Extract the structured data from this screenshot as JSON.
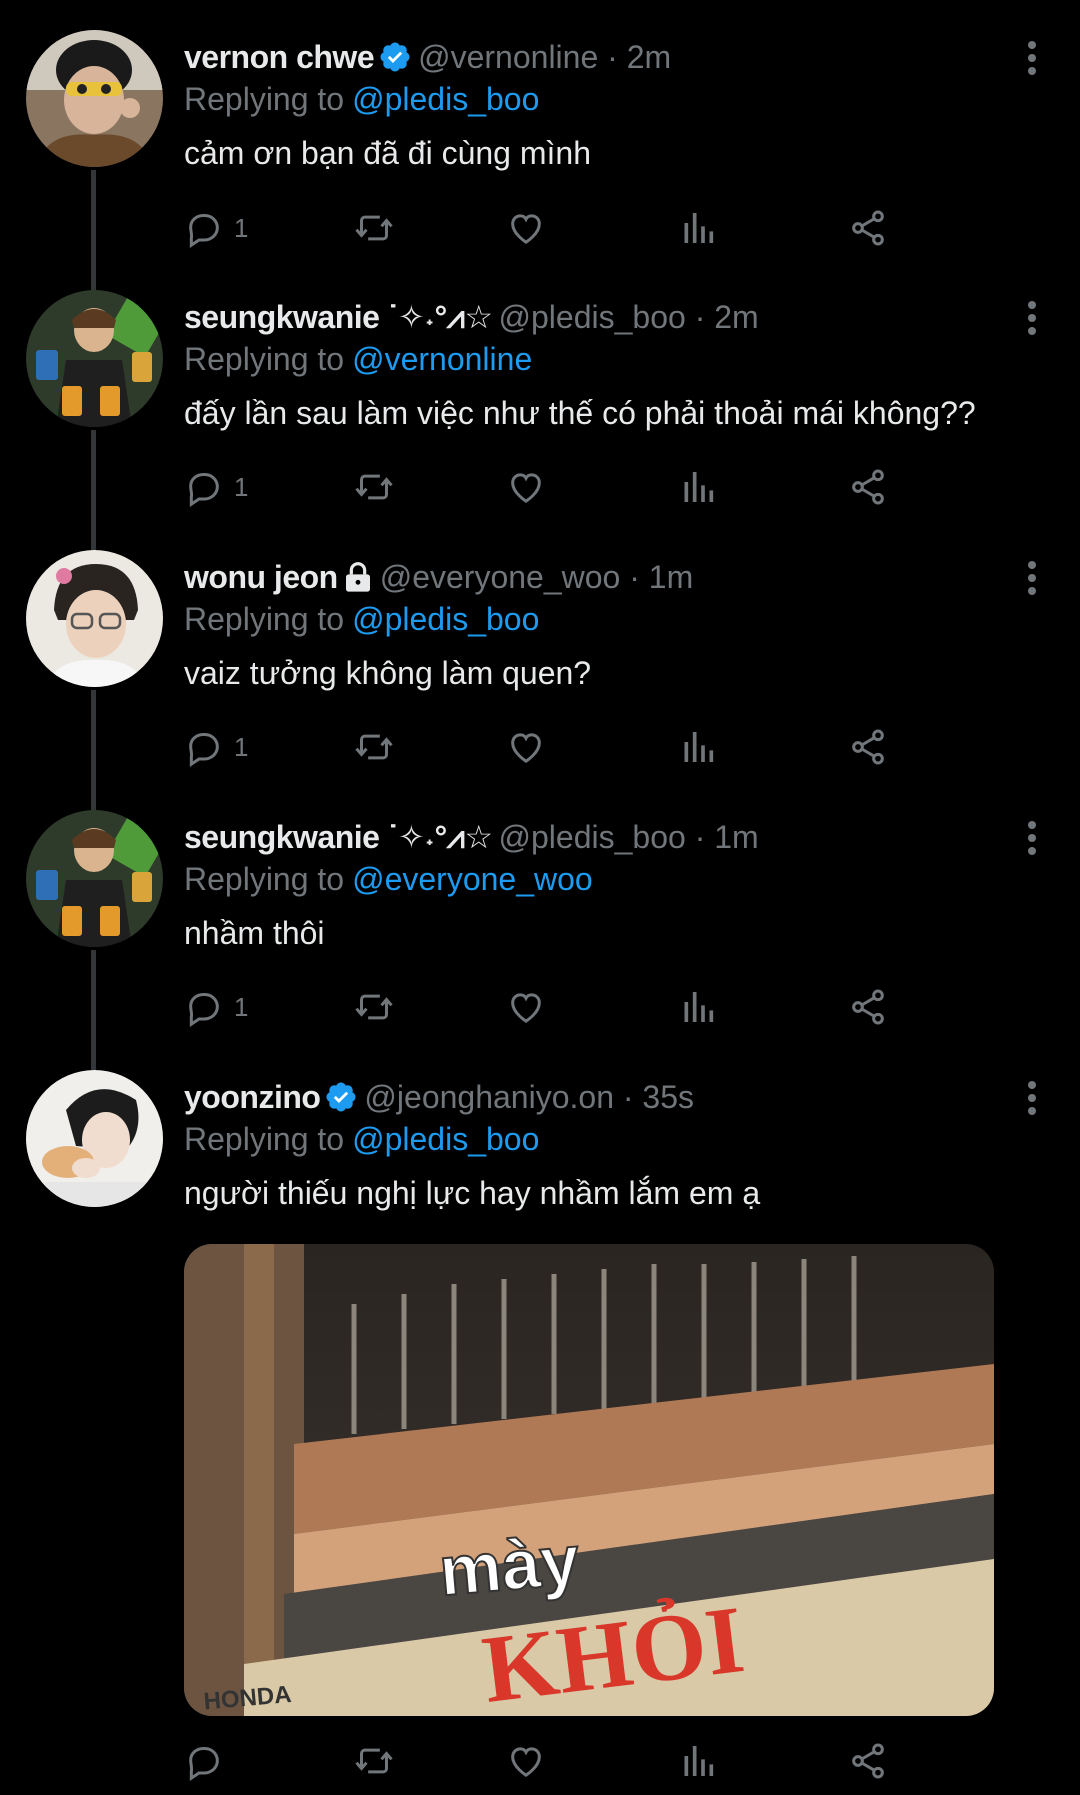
{
  "tweets": [
    {
      "name": "vernon chwe",
      "handle": "@vernonline · 2m",
      "replying_label": "Replying to",
      "replying_to": "@pledis_boo",
      "text": "cảm ơn bạn đã đi cùng mình",
      "reply_count": "1",
      "verified": true
    },
    {
      "name": "seungkwanie ˙✧˖°⩘☆",
      "handle": "@pledis_boo · 2m",
      "replying_label": "Replying to",
      "replying_to": "@vernonline",
      "text": "đấy lần sau làm việc như thế có phải thoải mái không??",
      "reply_count": "1"
    },
    {
      "name": "wonu jeon",
      "handle": "@everyone_woo · 1m",
      "replying_label": "Replying to",
      "replying_to": "@pledis_boo",
      "text": "vaiz tưởng không làm quen?",
      "reply_count": "1",
      "locked": true
    },
    {
      "name": "seungkwanie ˙✧˖°⩘☆",
      "handle": "@pledis_boo · 1m",
      "replying_label": "Replying to",
      "replying_to": "@everyone_woo",
      "text": "nhầm thôi",
      "reply_count": "1"
    },
    {
      "name": "yoonzino",
      "handle": "@jeonghaniyo.on · 35s",
      "replying_label": "Replying to",
      "replying_to": "@pledis_boo",
      "text": "người thiếu nghị lực hay nhầm lắm em ạ",
      "verified": true,
      "media": {
        "caption": "mày",
        "sign_text": "KHỎI",
        "sign_brand": "HONDA"
      }
    }
  ],
  "icons": {
    "reply": "reply-icon",
    "retweet": "retweet-icon",
    "like": "heart-icon",
    "views": "views-icon",
    "share": "share-icon",
    "more": "more-vertical-icon"
  },
  "colors": {
    "background": "#000000",
    "text": "#e7e9ea",
    "muted": "#71767b",
    "accent": "#1d9bf0"
  }
}
